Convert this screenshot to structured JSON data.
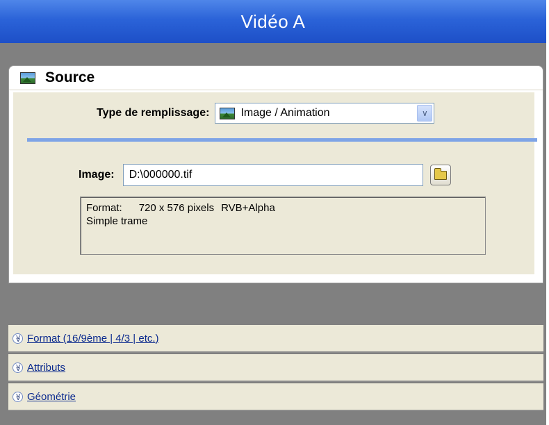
{
  "window": {
    "title": "Vidéo A"
  },
  "source": {
    "header": "Source",
    "fill_type_label": "Type de remplissage:",
    "fill_type_value": "Image / Animation",
    "image_label": "Image:",
    "image_path": "D:\\000000.tif",
    "info": {
      "format_label": "Format:",
      "dimensions": "720 x 576 pixels",
      "color_mode": "RVB+Alpha",
      "frame_type": "Simple trame"
    }
  },
  "sections": [
    {
      "label": "Format (16/9ème | 4/3 | etc.)"
    },
    {
      "label": "Attributs"
    },
    {
      "label": "Géométrie"
    }
  ],
  "colors": {
    "title_bar": "#2b63d8",
    "panel_bg": "#808080",
    "section_bg": "#ece9d8",
    "separator": "#7ea4e6",
    "link": "#0b2a8e"
  },
  "icons": {
    "source": "picture-icon",
    "fill_type": "picture-icon",
    "dropdown": "chevron-down-icon",
    "browse": "folder-icon",
    "section_toggle": "double-chevron-down-icon"
  }
}
